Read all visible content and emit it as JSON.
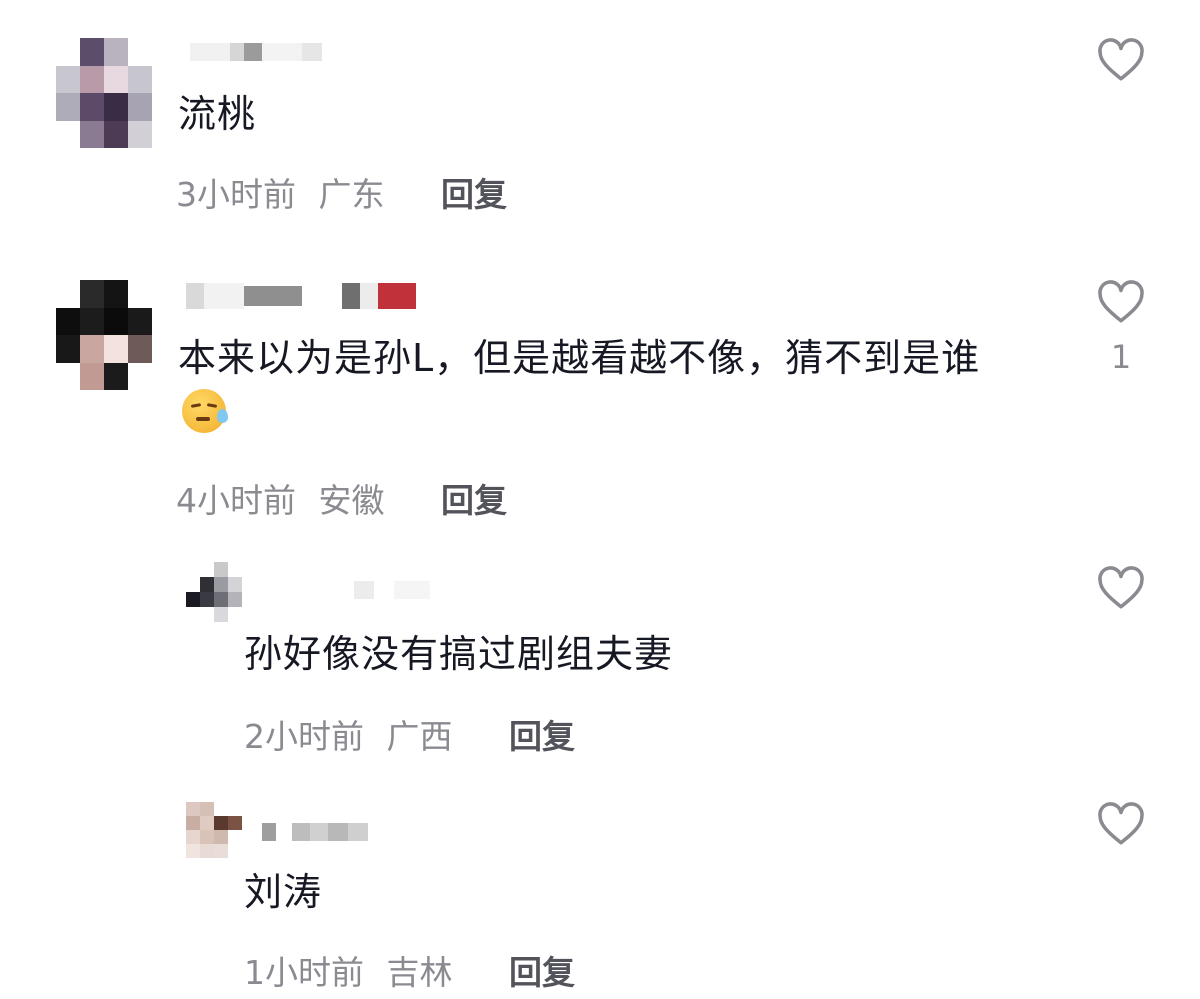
{
  "comments": [
    {
      "text": "流桃",
      "time": "3小时前",
      "location": "广东",
      "reply_label": "回复",
      "like_count": ""
    },
    {
      "text": "本来以为是孙L，但是越看越不像，猜不到是谁",
      "emoji": "sweat-smile-emoji",
      "time": "4小时前",
      "location": "安徽",
      "reply_label": "回复",
      "like_count": "1"
    },
    {
      "text": "孙好像没有搞过剧组夫妻",
      "time": "2小时前",
      "location": "广西",
      "reply_label": "回复",
      "like_count": ""
    },
    {
      "text": "刘涛",
      "time": "1小时前",
      "location": "吉林",
      "reply_label": "回复",
      "like_count": ""
    }
  ],
  "colors": {
    "text": "#161823",
    "meta": "#8a8b91",
    "reply": "#53545b",
    "heart_outline": "#8a8b91"
  }
}
